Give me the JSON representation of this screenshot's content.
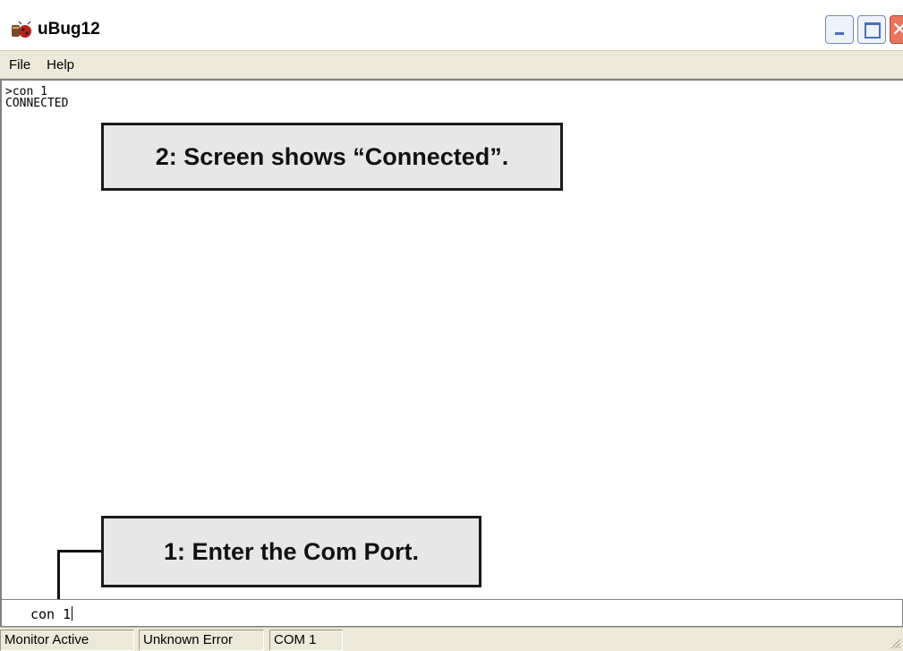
{
  "window": {
    "title": "uBug12",
    "icon": "bug-app-icon"
  },
  "menu": {
    "items": [
      "File",
      "Help"
    ]
  },
  "output": {
    "lines": [
      ">con 1",
      "CONNECTED"
    ]
  },
  "callouts": {
    "step2": "2: Screen shows “Connected”.",
    "step1": "1: Enter the Com Port."
  },
  "command": {
    "value": "con 1"
  },
  "status": {
    "panes": [
      "Monitor Active",
      "Unknown Error",
      "COM 1"
    ]
  },
  "colors": {
    "menu_bg": "#ece9d8",
    "callout_bg": "#e7e7e7",
    "close_button": "#e8755c",
    "titlebar_button_border": "#6d89c8"
  }
}
